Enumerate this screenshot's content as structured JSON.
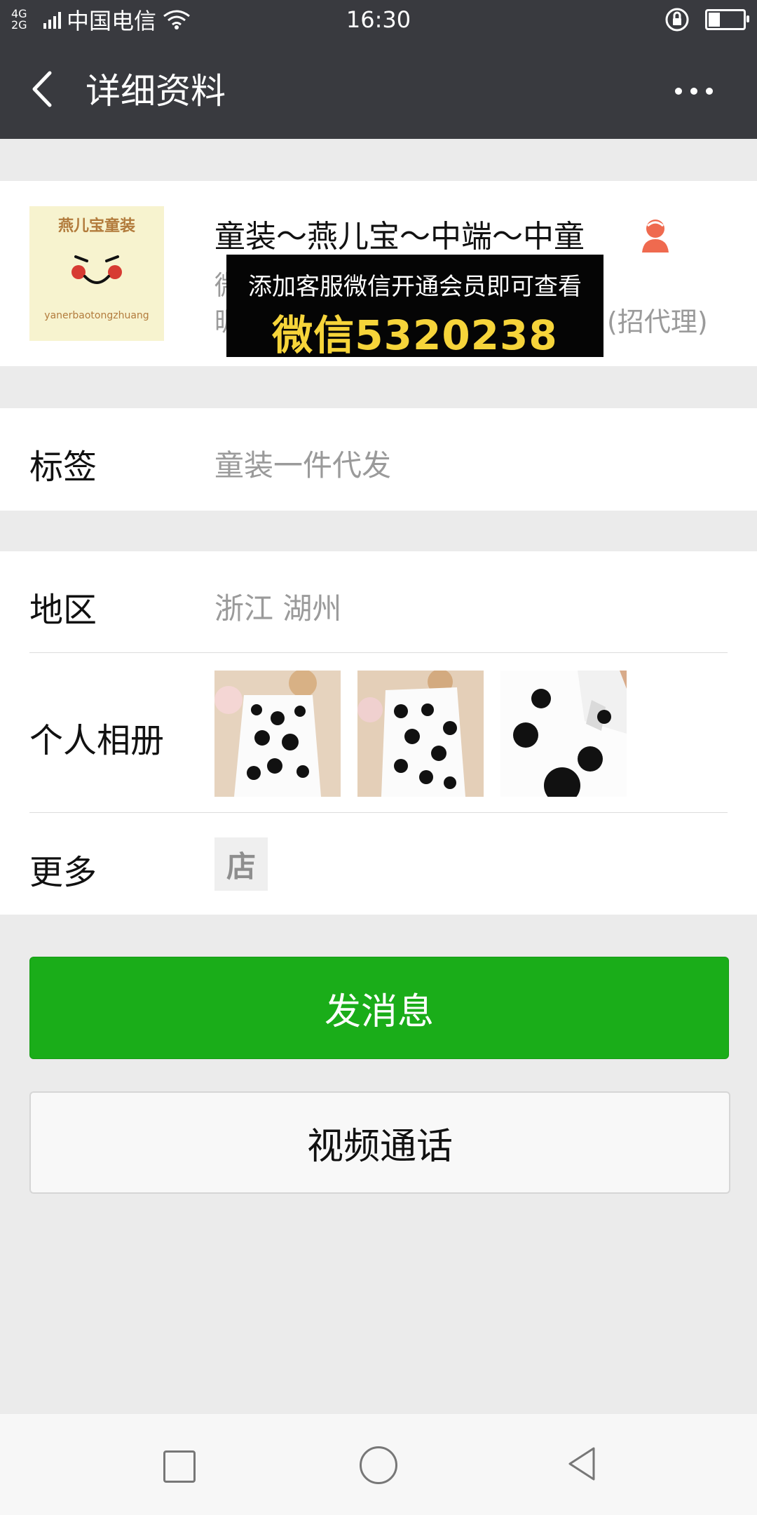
{
  "status_bar": {
    "network": "4G\n2G",
    "carrier": "中国电信",
    "time": "16:30"
  },
  "nav": {
    "title": "详细资料"
  },
  "profile": {
    "name": "童装～燕儿宝～中端～中童",
    "line2": "微",
    "line3": "昵",
    "line3_suffix": "(招代理)",
    "avatar_brand": "燕儿宝童装",
    "avatar_sub": "yanerbaotongzhuang"
  },
  "ad_overlay": {
    "line1": "添加客服微信开通会员即可查看",
    "line2": "微信5320238"
  },
  "tags": {
    "label": "标签",
    "value": "童装一件代发"
  },
  "info": {
    "region_label": "地区",
    "region_value": "浙江  湖州",
    "album_label": "个人相册",
    "more_label": "更多",
    "store_icon": "店"
  },
  "actions": {
    "send_message": "发消息",
    "video_call": "视频通话"
  },
  "colors": {
    "topbar": "#393a3f",
    "background": "#ebebeb",
    "primary_button": "#1aad19",
    "secondary_text": "#9a9a9a"
  }
}
